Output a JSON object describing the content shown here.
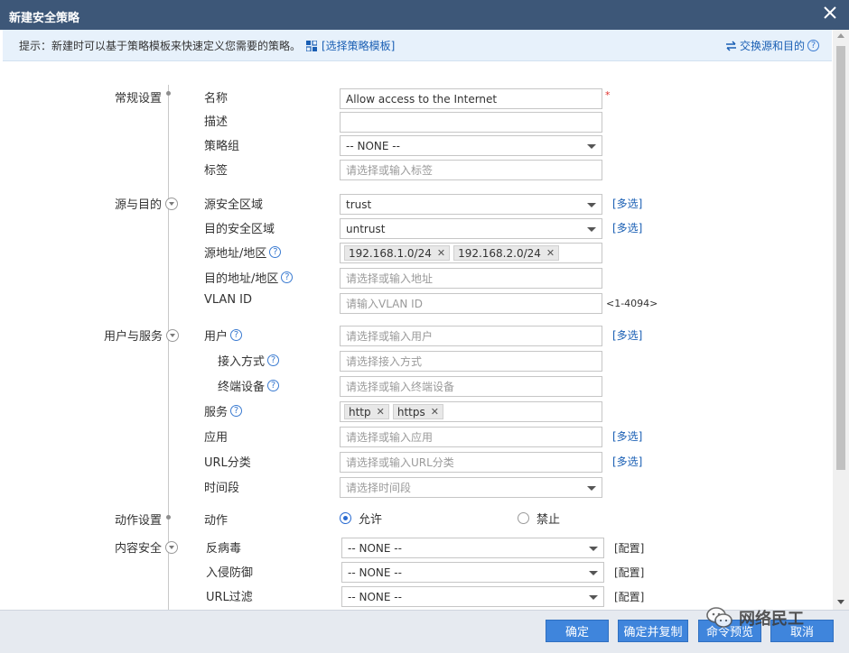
{
  "dialog": {
    "title": "新建安全策略"
  },
  "tip": {
    "text": "提示：新建时可以基于策略模板来快速定义您需要的策略。",
    "template_link": "[选择策略模板]",
    "swap_link": "交换源和目的"
  },
  "sections": {
    "general": "常规设置",
    "src_dst": "源与目的",
    "user_service": "用户与服务",
    "action": "动作设置",
    "content": "内容安全"
  },
  "fields": {
    "name": {
      "label": "名称",
      "value": "Allow access to the Internet",
      "required_mark": "*"
    },
    "description": {
      "label": "描述",
      "value": ""
    },
    "policy_group": {
      "label": "策略组",
      "value": "-- NONE --"
    },
    "tag": {
      "label": "标签",
      "placeholder": "请选择或输入标签"
    },
    "src_zone": {
      "label": "源安全区域",
      "value": "trust",
      "link": "[多选]"
    },
    "dst_zone": {
      "label": "目的安全区域",
      "value": "untrust",
      "link": "[多选]"
    },
    "src_addr": {
      "label": "源地址/地区",
      "tags": [
        "192.168.1.0/24",
        "192.168.2.0/24"
      ]
    },
    "dst_addr": {
      "label": "目的地址/地区",
      "placeholder": "请选择或输入地址"
    },
    "vlan": {
      "label": "VLAN ID",
      "placeholder": "请输入VLAN ID",
      "hint": "<1-4094>"
    },
    "user": {
      "label": "用户",
      "placeholder": "请选择或输入用户",
      "link": "[多选]"
    },
    "access_mode": {
      "label": "接入方式",
      "placeholder": "请选择接入方式"
    },
    "terminal": {
      "label": "终端设备",
      "placeholder": "请选择或输入终端设备"
    },
    "service": {
      "label": "服务",
      "tags": [
        "http",
        "https"
      ]
    },
    "application": {
      "label": "应用",
      "placeholder": "请选择或输入应用",
      "link": "[多选]"
    },
    "url_category": {
      "label": "URL分类",
      "placeholder": "请选择或输入URL分类",
      "link": "[多选]"
    },
    "time_range": {
      "label": "时间段",
      "placeholder": "请选择时间段"
    },
    "action": {
      "label": "动作",
      "options": [
        "允许",
        "禁止"
      ],
      "selected": "允许"
    },
    "antivirus": {
      "label": "反病毒",
      "value": "-- NONE --",
      "config": "[配置]"
    },
    "ips": {
      "label": "入侵防御",
      "value": "-- NONE --",
      "config": "[配置]"
    },
    "url_filter": {
      "label": "URL过滤",
      "value": "-- NONE --",
      "config": "[配置]"
    }
  },
  "buttons": {
    "ok": "确定",
    "ok_copy": "确定并复制",
    "preview": "命令预览",
    "cancel": "取消"
  },
  "watermark": {
    "text": "网络民工"
  },
  "colors": {
    "titlebar": "#3d5778",
    "accent": "#3f85dc",
    "link": "#1a5fb4",
    "required": "#e0312b"
  }
}
